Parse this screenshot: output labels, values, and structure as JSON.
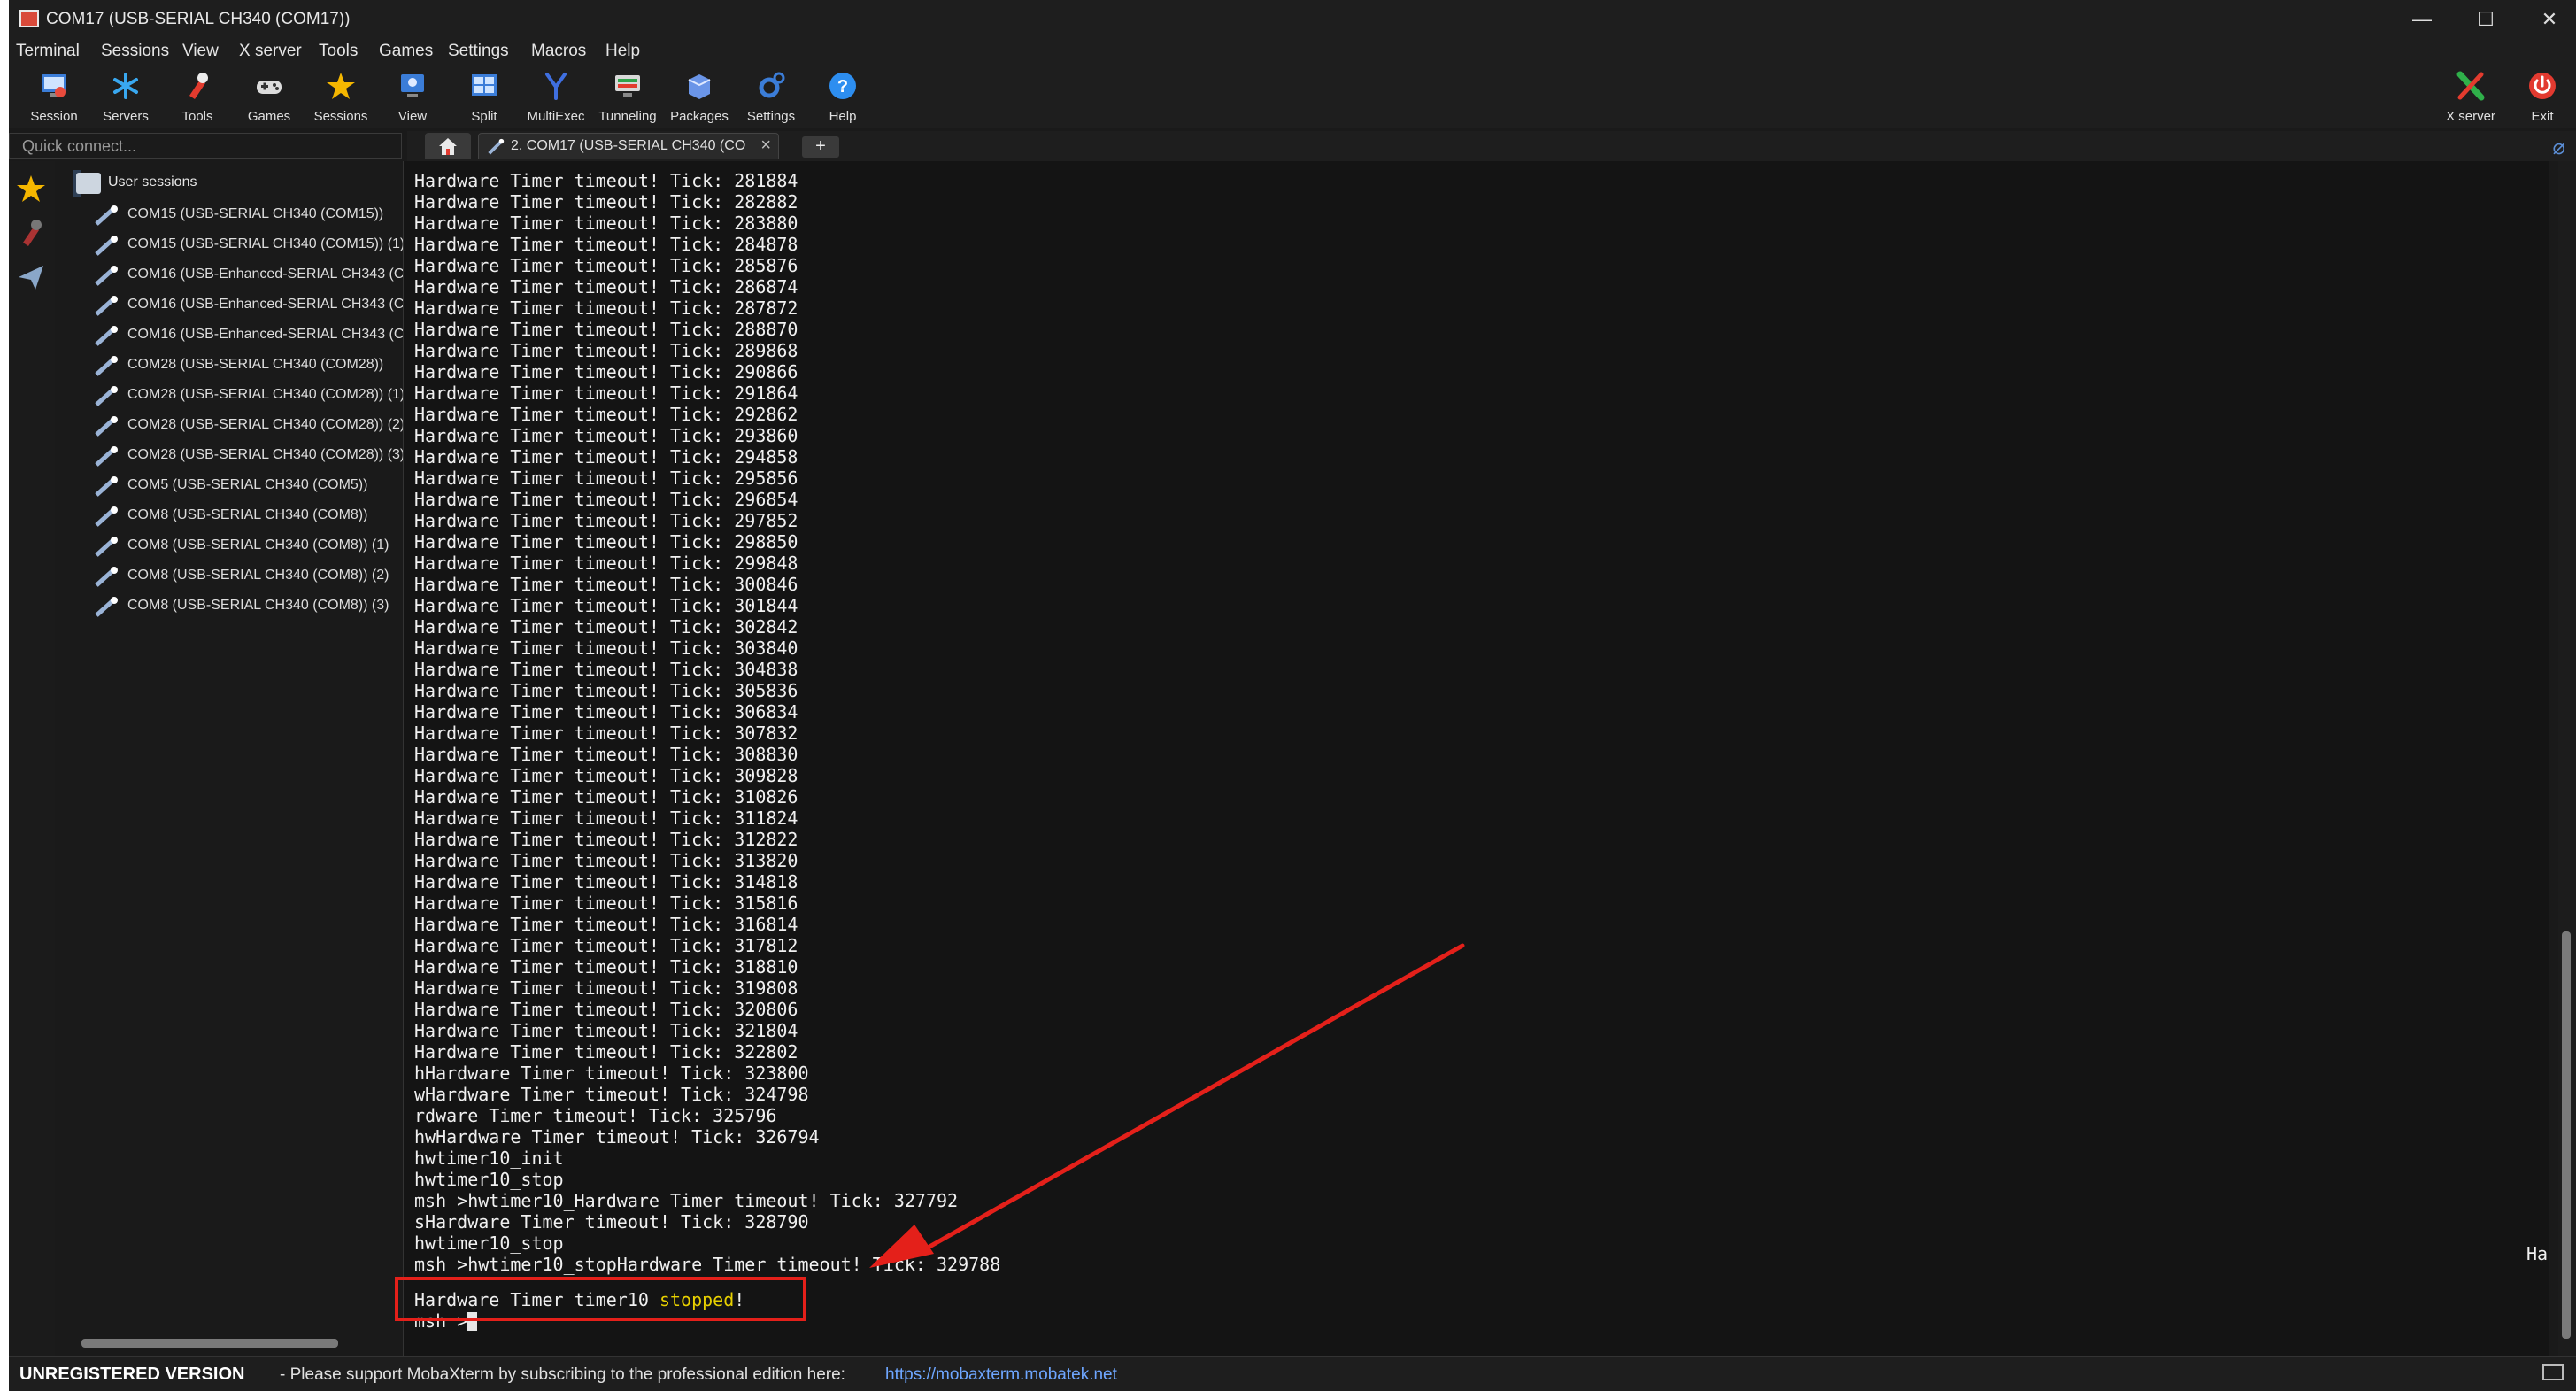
{
  "window": {
    "title": "COM17  (USB-SERIAL CH340 (COM17))",
    "controls": {
      "minimize": "—",
      "maximize": "☐",
      "close": "✕"
    }
  },
  "menu": [
    "Terminal",
    "Sessions",
    "View",
    "X server",
    "Tools",
    "Games",
    "Settings",
    "Macros",
    "Help"
  ],
  "toolbar": {
    "buttons": [
      {
        "label": "Session",
        "icon": "session-icon"
      },
      {
        "label": "Servers",
        "icon": "servers-icon"
      },
      {
        "label": "Tools",
        "icon": "tools-icon"
      },
      {
        "label": "Games",
        "icon": "games-icon"
      },
      {
        "label": "Sessions",
        "icon": "star-icon"
      },
      {
        "label": "View",
        "icon": "view-icon"
      },
      {
        "label": "Split",
        "icon": "split-icon"
      },
      {
        "label": "MultiExec",
        "icon": "multiexec-icon"
      },
      {
        "label": "Tunneling",
        "icon": "tunneling-icon"
      },
      {
        "label": "Packages",
        "icon": "packages-icon"
      },
      {
        "label": "Settings",
        "icon": "gear-icon"
      },
      {
        "label": "Help",
        "icon": "help-icon"
      }
    ],
    "right": {
      "xserver": "X server",
      "exit": "Exit"
    }
  },
  "quick_connect": {
    "placeholder": "Quick connect..."
  },
  "tabs": {
    "active_label": "2. COM17  (USB-SERIAL CH340 (CO",
    "new_tab": "+"
  },
  "sessions": {
    "root": "User sessions",
    "items": [
      "COM15  (USB-SERIAL CH340 (COM15))",
      "COM15  (USB-SERIAL CH340 (COM15)) (1)",
      "COM16  (USB-Enhanced-SERIAL CH343 (CO",
      "COM16  (USB-Enhanced-SERIAL CH343 (CO",
      "COM16  (USB-Enhanced-SERIAL CH343 (CO",
      "COM28  (USB-SERIAL CH340 (COM28))",
      "COM28  (USB-SERIAL CH340 (COM28)) (1)",
      "COM28  (USB-SERIAL CH340 (COM28)) (2)",
      "COM28  (USB-SERIAL CH340 (COM28)) (3)",
      "COM5  (USB-SERIAL CH340 (COM5))",
      "COM8  (USB-SERIAL CH340 (COM8))",
      "COM8  (USB-SERIAL CH340 (COM8)) (1)",
      "COM8  (USB-SERIAL CH340 (COM8)) (2)",
      "COM8  (USB-SERIAL CH340 (COM8)) (3)"
    ]
  },
  "terminal": {
    "lines": [
      "Hardware Timer timeout! Tick: 281884",
      "Hardware Timer timeout! Tick: 282882",
      "Hardware Timer timeout! Tick: 283880",
      "Hardware Timer timeout! Tick: 284878",
      "Hardware Timer timeout! Tick: 285876",
      "Hardware Timer timeout! Tick: 286874",
      "Hardware Timer timeout! Tick: 287872",
      "Hardware Timer timeout! Tick: 288870",
      "Hardware Timer timeout! Tick: 289868",
      "Hardware Timer timeout! Tick: 290866",
      "Hardware Timer timeout! Tick: 291864",
      "Hardware Timer timeout! Tick: 292862",
      "Hardware Timer timeout! Tick: 293860",
      "Hardware Timer timeout! Tick: 294858",
      "Hardware Timer timeout! Tick: 295856",
      "Hardware Timer timeout! Tick: 296854",
      "Hardware Timer timeout! Tick: 297852",
      "Hardware Timer timeout! Tick: 298850",
      "Hardware Timer timeout! Tick: 299848",
      "Hardware Timer timeout! Tick: 300846",
      "Hardware Timer timeout! Tick: 301844",
      "Hardware Timer timeout! Tick: 302842",
      "Hardware Timer timeout! Tick: 303840",
      "Hardware Timer timeout! Tick: 304838",
      "Hardware Timer timeout! Tick: 305836",
      "Hardware Timer timeout! Tick: 306834",
      "Hardware Timer timeout! Tick: 307832",
      "Hardware Timer timeout! Tick: 308830",
      "Hardware Timer timeout! Tick: 309828",
      "Hardware Timer timeout! Tick: 310826",
      "Hardware Timer timeout! Tick: 311824",
      "Hardware Timer timeout! Tick: 312822",
      "Hardware Timer timeout! Tick: 313820",
      "Hardware Timer timeout! Tick: 314818",
      "Hardware Timer timeout! Tick: 315816",
      "Hardware Timer timeout! Tick: 316814",
      "Hardware Timer timeout! Tick: 317812",
      "Hardware Timer timeout! Tick: 318810",
      "Hardware Timer timeout! Tick: 319808",
      "Hardware Timer timeout! Tick: 320806",
      "Hardware Timer timeout! Tick: 321804",
      "Hardware Timer timeout! Tick: 322802",
      "hHardware Timer timeout! Tick: 323800",
      "wHardware Timer timeout! Tick: 324798",
      "rdware Timer timeout! Tick: 325796",
      "hwHardware Timer timeout! Tick: 326794",
      "hwtimer10_init",
      "hwtimer10_stop",
      "msh >hwtimer10_Hardware Timer timeout! Tick: 327792",
      "sHardware Timer timeout! Tick: 328790",
      "hwtimer10_stop",
      "msh >hwtimer10_stopHardware Timer timeout! Tick: 329788",
      ""
    ],
    "stopped_prefix": "Hardware Timer timer10 ",
    "stopped_word": "stopped",
    "stopped_suffix": "!",
    "prompt": "msh >",
    "right_fragment": "Ha"
  },
  "status": {
    "unregistered": "UNREGISTERED VERSION",
    "message": "-  Please support MobaXterm by subscribing to the professional edition here:",
    "link": "https://mobaxterm.mobatek.net"
  },
  "colors": {
    "highlight_box": "#e4201a",
    "arrow": "#e4201a",
    "stopped": "#e8d000"
  }
}
